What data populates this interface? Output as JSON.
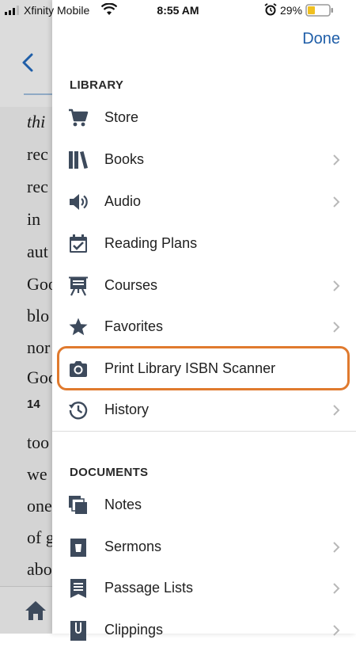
{
  "status_bar": {
    "carrier": "Xfinity Mobile",
    "time": "8:55 AM",
    "battery": "29%"
  },
  "reader": {
    "lines": [
      "thi",
      "rec",
      "rec",
      "in",
      "aut",
      "Goo",
      "blo",
      "nor",
      "Goo",
      "14",
      "too",
      "we",
      "one",
      "of g",
      "abo"
    ]
  },
  "drawer": {
    "done_label": "Done",
    "library_header": "LIBRARY",
    "library_items": [
      {
        "label": "Store",
        "icon": "cart-icon"
      },
      {
        "label": "Books",
        "icon": "books-icon"
      },
      {
        "label": "Audio",
        "icon": "speaker-icon"
      },
      {
        "label": "Reading Plans",
        "icon": "calendar-check-icon"
      },
      {
        "label": "Courses",
        "icon": "easel-icon"
      },
      {
        "label": "Favorites",
        "icon": "star-icon"
      },
      {
        "label": "Print Library ISBN Scanner",
        "icon": "camera-icon"
      },
      {
        "label": "History",
        "icon": "history-icon"
      }
    ],
    "documents_header": "DOCUMENTS",
    "document_items": [
      {
        "label": "Notes",
        "icon": "notes-icon"
      },
      {
        "label": "Sermons",
        "icon": "cup-icon"
      },
      {
        "label": "Passage Lists",
        "icon": "list-icon"
      },
      {
        "label": "Clippings",
        "icon": "clip-icon"
      }
    ]
  },
  "colors": {
    "accent": "#1f5ea8",
    "highlight": "#e07a2e",
    "icon": "#3d4a5c"
  }
}
